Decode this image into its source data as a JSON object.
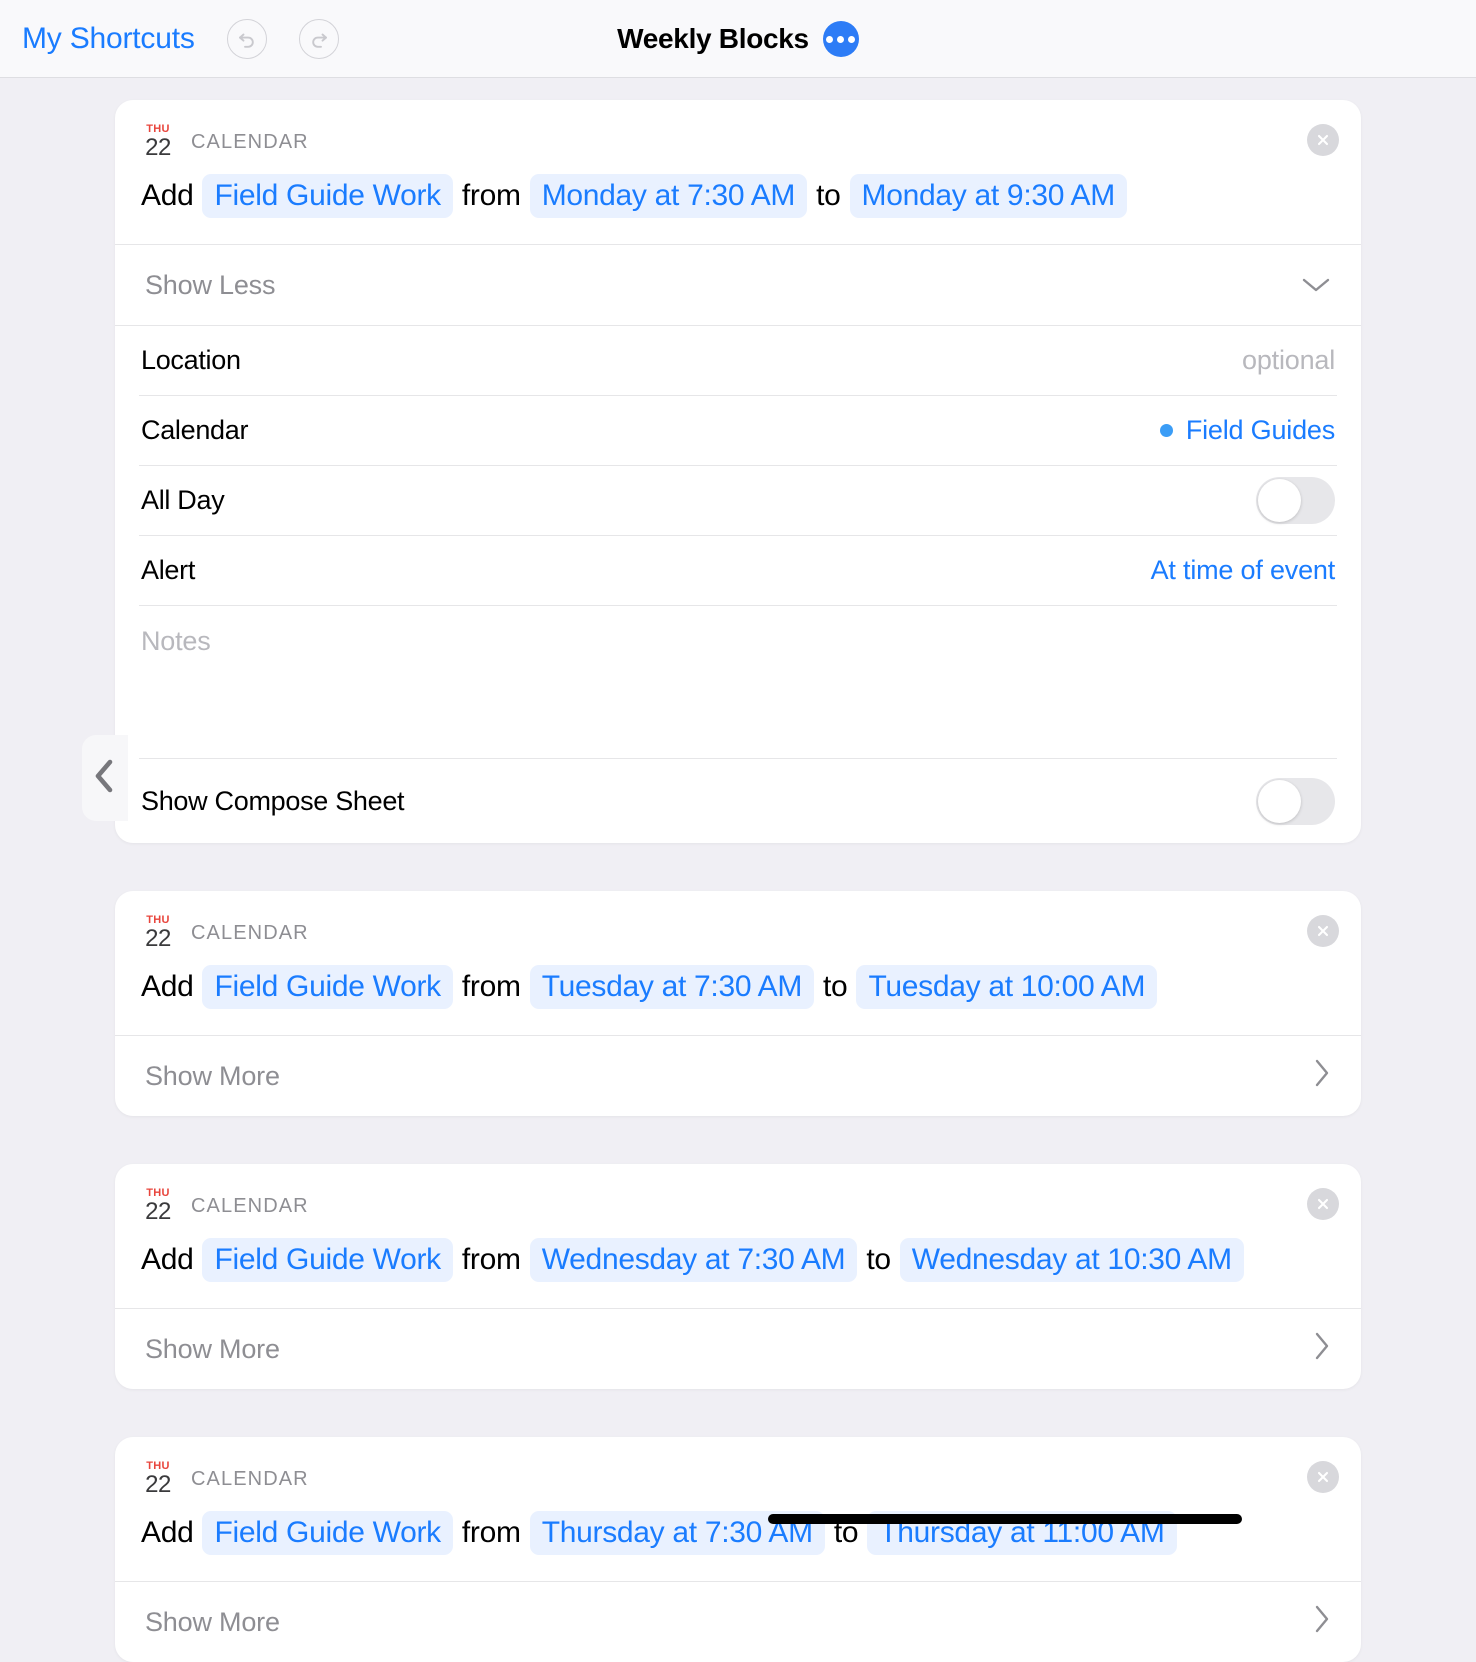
{
  "header": {
    "back_label": "My Shortcuts",
    "undo_icon": "undo-arrow-icon",
    "redo_icon": "redo-arrow-icon",
    "title": "Weekly Blocks",
    "more_icon": "ellipsis-icon",
    "accent_color": "#1a7cff"
  },
  "back_edge": {
    "icon": "chevron-left-icon"
  },
  "actions": [
    {
      "app_icon": {
        "dow": "THU",
        "day": "22"
      },
      "app_label": "CALENDAR",
      "close_icon": "close-circle-icon",
      "verb": "Add",
      "title_token": "Field Guide Work",
      "from_word": "from",
      "start_token": "Monday at 7:30 AM",
      "to_word": "to",
      "end_token": "Monday at 9:30 AM",
      "expanded": true,
      "disclosure_label": "Show Less",
      "disclosure_icon": "chevron-down-icon",
      "details": {
        "location_label": "Location",
        "location_value": "optional",
        "calendar_label": "Calendar",
        "calendar_value": "Field Guides",
        "calendar_dot_color": "#3b9df6",
        "all_day_label": "All Day",
        "all_day_on": false,
        "alert_label": "Alert",
        "alert_value": "At time of event",
        "notes_placeholder": "Notes",
        "compose_label": "Show Compose Sheet",
        "compose_on": false
      }
    },
    {
      "app_icon": {
        "dow": "THU",
        "day": "22"
      },
      "app_label": "CALENDAR",
      "close_icon": "close-circle-icon",
      "verb": "Add",
      "title_token": "Field Guide Work",
      "from_word": "from",
      "start_token": "Tuesday at 7:30 AM",
      "to_word": "to",
      "end_token": "Tuesday at 10:00 AM",
      "expanded": false,
      "disclosure_label": "Show More",
      "disclosure_icon": "chevron-right-icon"
    },
    {
      "app_icon": {
        "dow": "THU",
        "day": "22"
      },
      "app_label": "CALENDAR",
      "close_icon": "close-circle-icon",
      "verb": "Add",
      "title_token": "Field Guide Work",
      "from_word": "from",
      "start_token": "Wednesday at 7:30 AM",
      "to_word": "to",
      "end_token": "Wednesday at 10:30 AM",
      "expanded": false,
      "disclosure_label": "Show More",
      "disclosure_icon": "chevron-right-icon"
    },
    {
      "app_icon": {
        "dow": "THU",
        "day": "22"
      },
      "app_label": "CALENDAR",
      "close_icon": "close-circle-icon",
      "verb": "Add",
      "title_token": "Field Guide Work",
      "from_word": "from",
      "start_token": "Thursday at 7:30 AM",
      "to_word": "to",
      "end_token": "Thursday at 11:00 AM",
      "expanded": false,
      "disclosure_label": "Show More",
      "disclosure_icon": "chevron-right-icon"
    }
  ]
}
